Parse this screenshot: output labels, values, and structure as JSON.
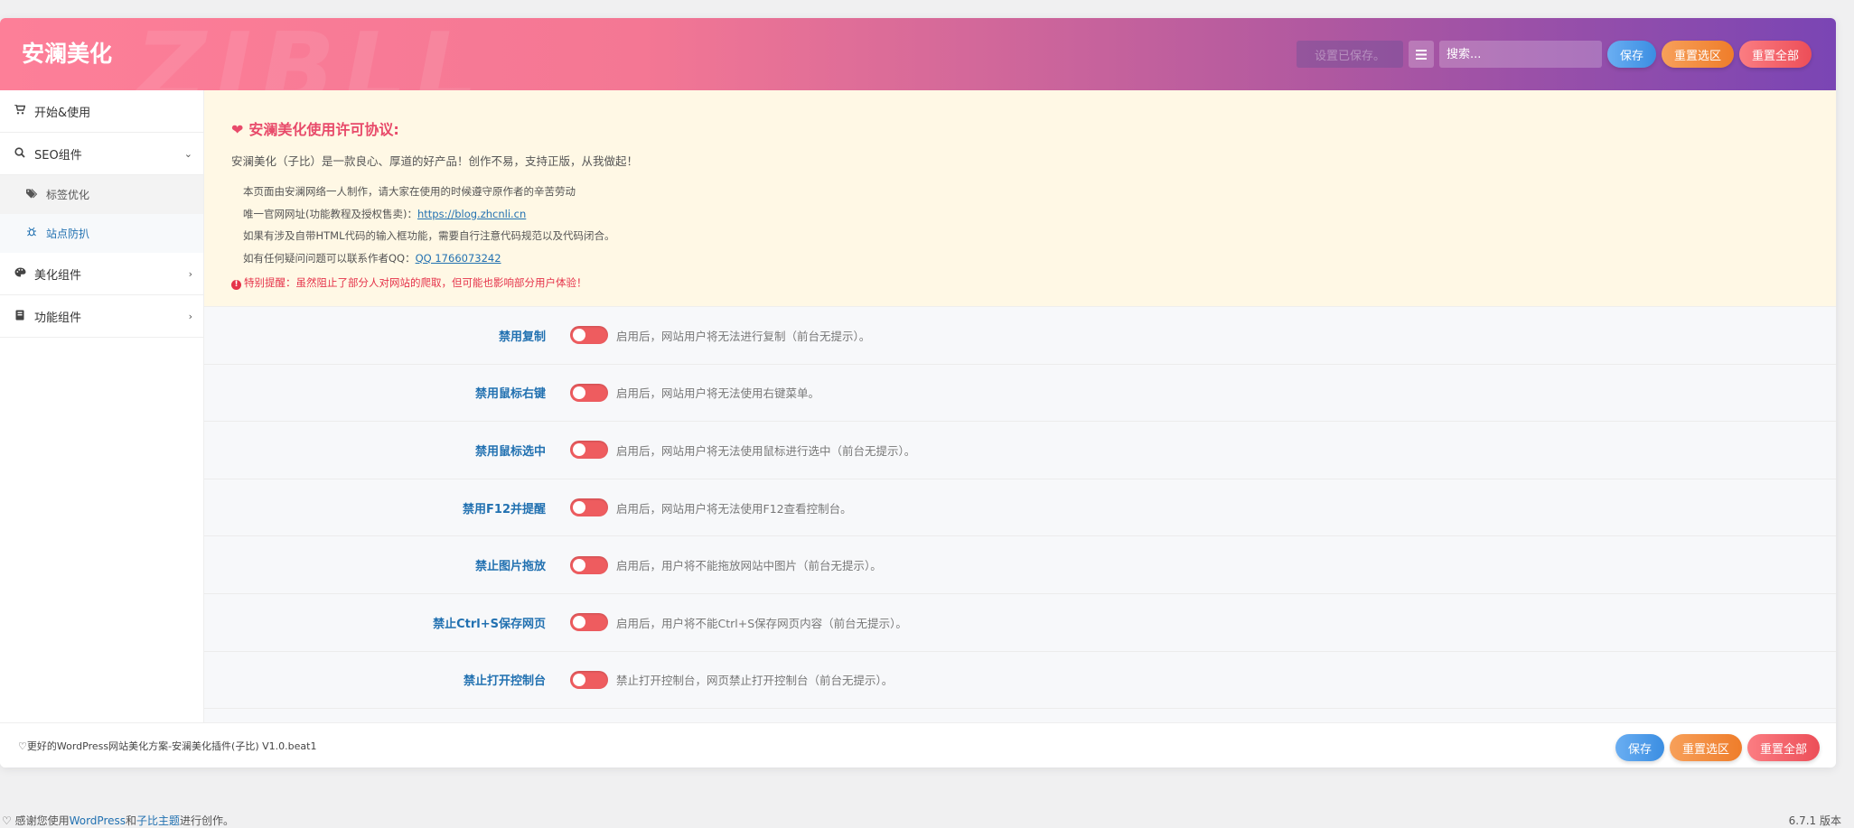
{
  "header": {
    "brand": "安澜美化",
    "watermark": "ZIBLL",
    "saved_note": "设置已保存。",
    "search_placeholder": "搜索...",
    "save_label": "保存",
    "reset_section_label": "重置选区",
    "reset_all_label": "重置全部"
  },
  "sidebar": {
    "items": [
      {
        "label": "开始&使用",
        "icon": "cart-icon"
      },
      {
        "label": "SEO组件",
        "icon": "search-icon",
        "chevron": "⌄"
      },
      {
        "label": "标签优化",
        "icon": "tags-icon"
      },
      {
        "label": "站点防扒",
        "icon": "spider-icon"
      },
      {
        "label": "美化组件",
        "icon": "palette-icon",
        "chevron": "›"
      },
      {
        "label": "功能组件",
        "icon": "book-icon",
        "chevron": "›"
      }
    ]
  },
  "notice": {
    "title": "安澜美化使用许可协议:",
    "lead": "安澜美化（子比）是一款良心、厚道的好产品！创作不易，支持正版，从我做起！",
    "line1": "本页面由安澜网络一人制作，请大家在使用的时候遵守原作者的辛苦劳动",
    "line2_prefix": "唯一官网网址(功能教程及授权售卖)：",
    "line2_link": "https://blog.zhcnli.cn",
    "line3": "如果有涉及自带HTML代码的输入框功能，需要自行注意代码规范以及代码闭合。",
    "line4_prefix": "如有任何疑问问题可以联系作者QQ：",
    "line4_link": "QQ 1766073242",
    "warning": "特别提醒：虽然阻止了部分人对网站的爬取，但可能也影响部分用户体验！"
  },
  "options": [
    {
      "label": "禁用复制",
      "desc": "启用后，网站用户将无法进行复制（前台无提示）。",
      "enabled": true
    },
    {
      "label": "禁用鼠标右键",
      "desc": "启用后，网站用户将无法使用右键菜单。",
      "enabled": true
    },
    {
      "label": "禁用鼠标选中",
      "desc": "启用后，网站用户将无法使用鼠标进行选中（前台无提示）。",
      "enabled": true
    },
    {
      "label": "禁用F12并提醒",
      "desc": "启用后，网站用户将无法使用F12查看控制台。",
      "enabled": true
    },
    {
      "label": "禁止图片拖放",
      "desc": "启用后，用户将不能拖放网站中图片（前台无提示）。",
      "enabled": true
    },
    {
      "label": "禁止Ctrl+S保存网页",
      "desc": "启用后，用户将不能Ctrl+S保存网页内容（前台无提示）。",
      "enabled": true
    },
    {
      "label": "禁止打开控制台",
      "desc": "禁止打开控制台，网页禁止打开控制台（前台无提示）。",
      "enabled": true
    }
  ],
  "footer": {
    "text": "♡更好的WordPress网站美化方案-安澜美化插件(子比) V1.0.beat1",
    "save_label": "保存",
    "reset_section_label": "重置选区",
    "reset_all_label": "重置全部"
  },
  "wp": {
    "credit_prefix": "♡ 感谢您使用",
    "credit_wp": "WordPress",
    "credit_and": "和",
    "credit_theme": "子比主题",
    "credit_suffix": "进行创作。",
    "version": "6.7.1 版本"
  },
  "colors": {
    "header_start": "#fd7f98",
    "header_end": "#7a45b4",
    "label_blue": "#2271b1",
    "toggle_red": "#ee5c5f",
    "notice_bg": "#fff8e5",
    "notice_title": "#e84a6a",
    "warning_red": "#e5334a"
  }
}
